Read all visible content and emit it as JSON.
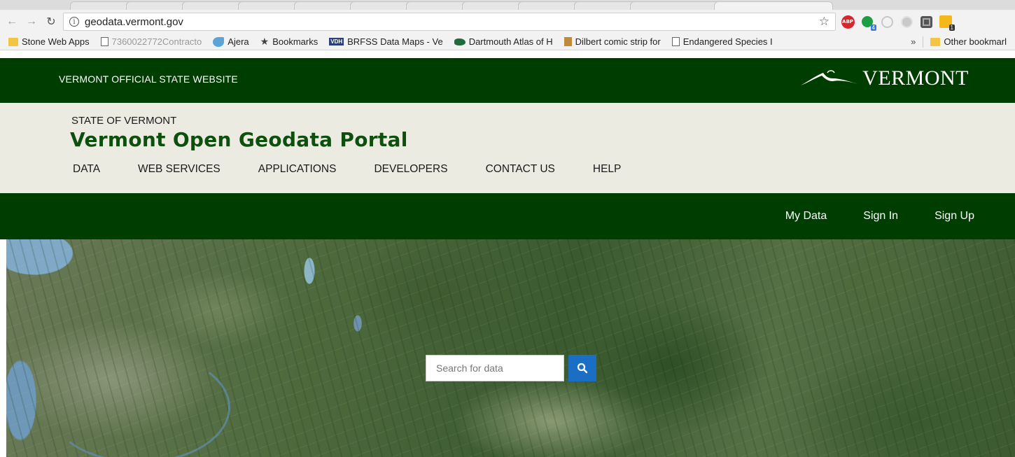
{
  "browser": {
    "url": "geodata.vermont.gov",
    "bookmarks": [
      {
        "label": "Stone Web Apps",
        "icon": "folder-icon"
      },
      {
        "label": "7360022772Contracto",
        "icon": "page-icon"
      },
      {
        "label": "Ajera",
        "icon": "ajera-icon"
      },
      {
        "label": "Bookmarks",
        "icon": "star-icon"
      },
      {
        "label": "BRFSS Data Maps - Ve",
        "icon": "vdh-icon"
      },
      {
        "label": "Dartmouth Atlas of H",
        "icon": "dartmouth-icon"
      },
      {
        "label": "Dilbert comic strip for",
        "icon": "dilbert-icon"
      },
      {
        "label": "Endangered Species I",
        "icon": "page-icon"
      }
    ],
    "overflow_chevron": "»",
    "other_bookmarks": "Other bookmarl",
    "extension_badges": {
      "messaging": "4",
      "notes": "1"
    },
    "abp_label": "ABP"
  },
  "site": {
    "official_label": "VERMONT OFFICIAL STATE WEBSITE",
    "logo_text": "VERMONT",
    "state_label": "STATE OF VERMONT",
    "portal_title": "Vermont Open Geodata Portal",
    "nav": [
      "DATA",
      "WEB SERVICES",
      "APPLICATIONS",
      "DEVELOPERS",
      "CONTACT US",
      "HELP"
    ],
    "user_links": [
      "My Data",
      "Sign In",
      "Sign Up"
    ],
    "search": {
      "placeholder": "Search for data"
    }
  },
  "colors": {
    "header_green": "#003d00",
    "title_green": "#0d4f0d",
    "header_beige": "#ecebe1",
    "search_button": "#1a6fc4"
  }
}
